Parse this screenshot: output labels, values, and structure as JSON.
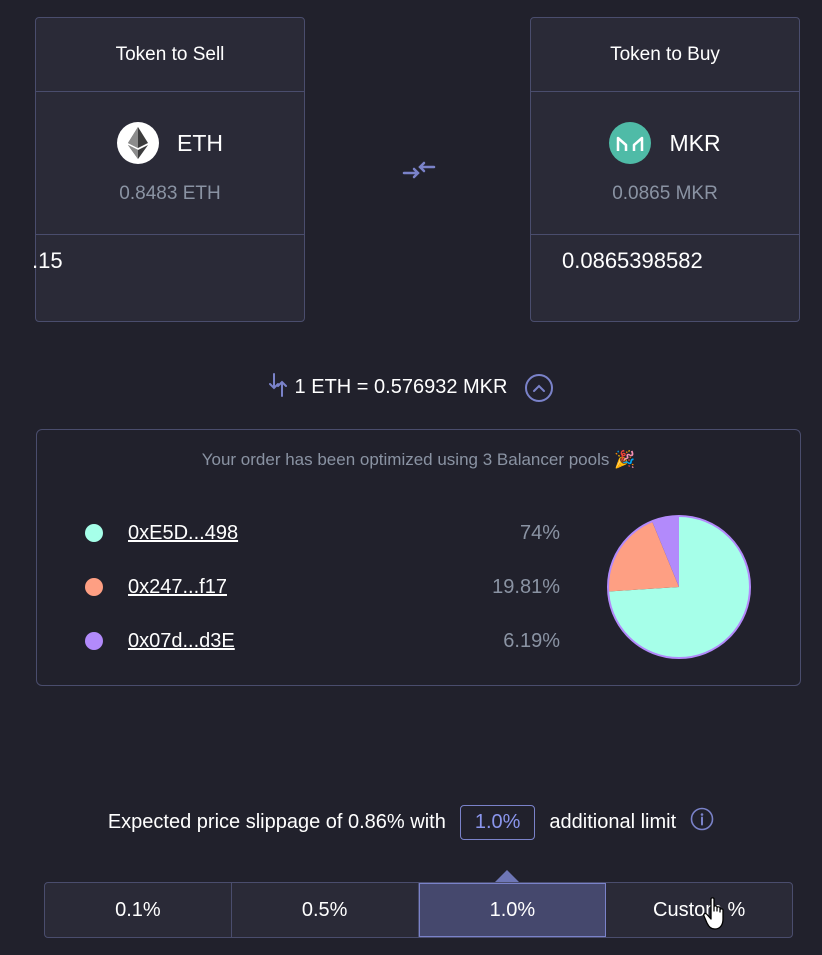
{
  "sell": {
    "header": "Token to Sell",
    "symbol": "ETH",
    "balance": "0.8483 ETH",
    "amount": ".15",
    "icon": "ethereum-icon"
  },
  "buy": {
    "header": "Token to Buy",
    "symbol": "MKR",
    "balance": "0.0865 MKR",
    "amount": "0.0865398582",
    "icon": "maker-icon"
  },
  "rate": {
    "text": "1 ETH = 0.576932 MKR"
  },
  "pools": {
    "title": "Your order has been optimized using 3 Balancer pools",
    "items": [
      {
        "address": "0xE5D...498",
        "percent": "74%",
        "value": 74,
        "color": "#a6ffe9"
      },
      {
        "address": "0x247...f17",
        "percent": "19.81%",
        "value": 19.81,
        "color": "#fe9f83"
      },
      {
        "address": "0x07d...d3E",
        "percent": "6.19%",
        "value": 6.19,
        "color": "#b28afb"
      }
    ]
  },
  "slippage": {
    "prefix": "Expected price slippage of 0.86% with",
    "value": "1.0%",
    "suffix": "additional limit"
  },
  "options": [
    "0.1%",
    "0.5%",
    "1.0%",
    "Custom %"
  ],
  "colors": {
    "background": "#21212c",
    "panel": "#2a2a37",
    "border": "#4a4d6d",
    "accent": "#7a82c9"
  }
}
